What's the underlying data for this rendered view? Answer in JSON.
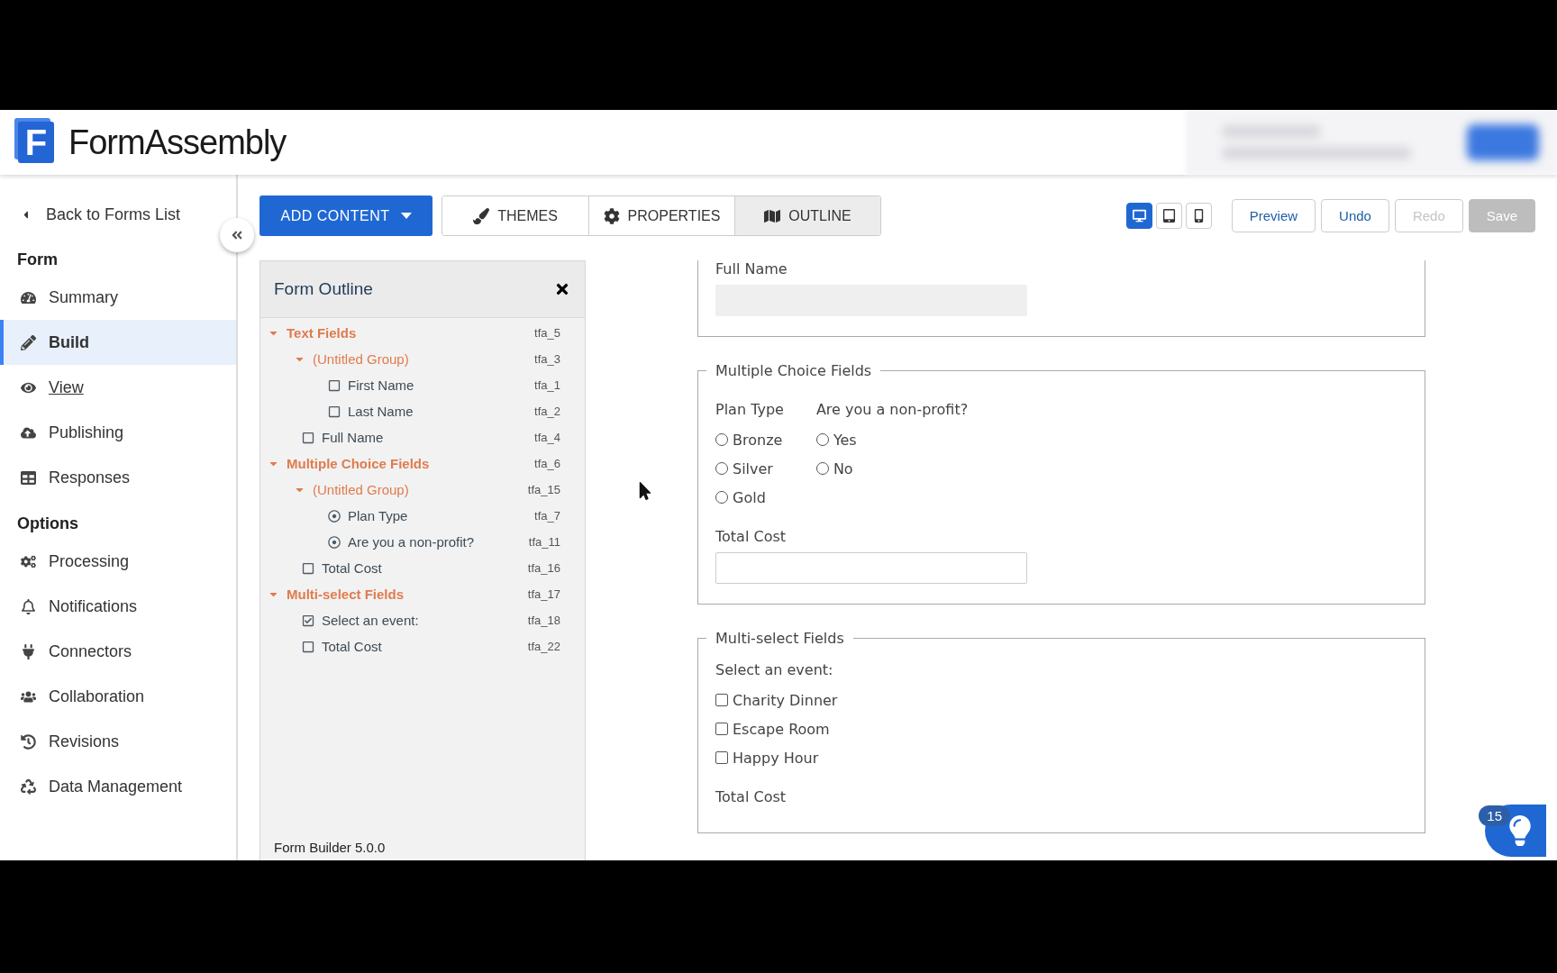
{
  "header": {
    "logo_mark": "F",
    "logo_text": "FormAssembly"
  },
  "sidebar": {
    "back_link": "Back to Forms List",
    "sections": [
      {
        "heading": "Form",
        "items": [
          {
            "label": "Summary",
            "selected": false,
            "hovered": false
          },
          {
            "label": "Build",
            "selected": true,
            "hovered": false
          },
          {
            "label": "View",
            "selected": false,
            "hovered": true
          },
          {
            "label": "Publishing",
            "selected": false,
            "hovered": false
          },
          {
            "label": "Responses",
            "selected": false,
            "hovered": false
          }
        ]
      },
      {
        "heading": "Options",
        "items": [
          {
            "label": "Processing",
            "selected": false,
            "hovered": false
          },
          {
            "label": "Notifications",
            "selected": false,
            "hovered": false
          },
          {
            "label": "Connectors",
            "selected": false,
            "hovered": false
          },
          {
            "label": "Collaboration",
            "selected": false,
            "hovered": false
          },
          {
            "label": "Revisions",
            "selected": false,
            "hovered": false
          },
          {
            "label": "Data Management",
            "selected": false,
            "hovered": false
          }
        ]
      }
    ]
  },
  "toolbar": {
    "add_content": "ADD CONTENT",
    "tabs": [
      {
        "label": "THEMES",
        "selected": false
      },
      {
        "label": "PROPERTIES",
        "selected": false
      },
      {
        "label": "OUTLINE",
        "selected": true
      }
    ],
    "devices": [
      {
        "selected": true
      },
      {
        "selected": false
      },
      {
        "selected": false
      }
    ],
    "actions": [
      {
        "label": "Preview",
        "kind": "outline",
        "disabled": false
      },
      {
        "label": "Undo",
        "kind": "outline",
        "disabled": false
      },
      {
        "label": "Redo",
        "kind": "outline",
        "disabled": true
      },
      {
        "label": "Save",
        "kind": "primary",
        "disabled": true
      }
    ]
  },
  "outline": {
    "title": "Form Outline",
    "footer": "Form Builder 5.0.0",
    "items": [
      {
        "kind": "section",
        "label": "Text Fields",
        "id": "tfa_5",
        "expanded": true,
        "children": [
          {
            "kind": "group",
            "label": "(Untitled Group)",
            "id": "tfa_3",
            "expanded": true,
            "children": [
              {
                "kind": "text",
                "label": "First Name",
                "id": "tfa_1"
              },
              {
                "kind": "text",
                "label": "Last Name",
                "id": "tfa_2"
              }
            ]
          },
          {
            "kind": "text",
            "label": "Full Name",
            "id": "tfa_4"
          }
        ]
      },
      {
        "kind": "section",
        "label": "Multiple Choice Fields",
        "id": "tfa_6",
        "expanded": true,
        "children": [
          {
            "kind": "group",
            "label": "(Untitled Group)",
            "id": "tfa_15",
            "expanded": true,
            "children": [
              {
                "kind": "radio",
                "label": "Plan Type",
                "id": "tfa_7"
              },
              {
                "kind": "radio",
                "label": "Are you a non-profit?",
                "id": "tfa_11"
              }
            ]
          },
          {
            "kind": "text",
            "label": "Total Cost",
            "id": "tfa_16"
          }
        ]
      },
      {
        "kind": "section",
        "label": "Multi-select Fields",
        "id": "tfa_17",
        "expanded": true,
        "children": [
          {
            "kind": "checkbox",
            "label": "Select an event:",
            "id": "tfa_18"
          },
          {
            "kind": "text",
            "label": "Total Cost",
            "id": "tfa_22"
          }
        ]
      }
    ]
  },
  "form": {
    "fieldsets": [
      {
        "fields": [
          {
            "kind": "text",
            "label": "Full Name",
            "disabled": true
          }
        ]
      },
      {
        "legend": "Multiple Choice Fields",
        "fields": [
          {
            "kind": "radio_row",
            "groups": [
              {
                "label": "Plan Type",
                "options": [
                  {
                    "label": "Bronze",
                    "selected": false
                  },
                  {
                    "label": "Silver",
                    "selected": false
                  },
                  {
                    "label": "Gold",
                    "selected": false
                  }
                ]
              },
              {
                "label": "Are you a non-profit?",
                "options": [
                  {
                    "label": "Yes",
                    "selected": false
                  },
                  {
                    "label": "No",
                    "selected": false
                  }
                ]
              }
            ]
          },
          {
            "kind": "text",
            "label": "Total Cost",
            "disabled": false
          }
        ]
      },
      {
        "legend": "Multi-select Fields",
        "fields": [
          {
            "kind": "checkbox",
            "label": "Select an event:",
            "options": [
              {
                "label": "Charity Dinner",
                "checked": false
              },
              {
                "label": "Escape Room",
                "checked": false
              },
              {
                "label": "Happy Hour",
                "checked": false
              }
            ]
          },
          {
            "kind": "label",
            "label": "Total Cost"
          }
        ]
      }
    ]
  },
  "help": {
    "badge": "15"
  }
}
